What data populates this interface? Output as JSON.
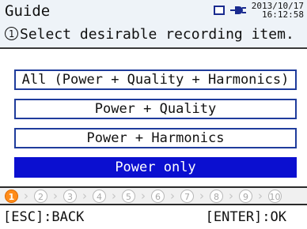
{
  "header": {
    "title": "Guide",
    "date": "2013/10/17",
    "time": "16:12:58",
    "instruction_number": "1",
    "instruction_text": "Select desirable recording item."
  },
  "icons": {
    "memory_card": "memory-card-icon",
    "power": "plug-icon"
  },
  "options": [
    {
      "label": "All (Power + Quality + Harmonics)",
      "selected": false
    },
    {
      "label": "Power + Quality",
      "selected": false
    },
    {
      "label": "Power + Harmonics",
      "selected": false
    },
    {
      "label": "Power only",
      "selected": true
    }
  ],
  "steps": {
    "current": 1,
    "items": [
      "1",
      "2",
      "3",
      "4",
      "5",
      "6",
      "7",
      "8",
      "9",
      "10"
    ]
  },
  "footer": {
    "back": "[ESC]:BACK",
    "ok": "[ENTER]:OK"
  },
  "colors": {
    "selected_bg": "#0b0fd0",
    "option_border": "#1f3c9c",
    "active_step": "#ff8c1a"
  }
}
